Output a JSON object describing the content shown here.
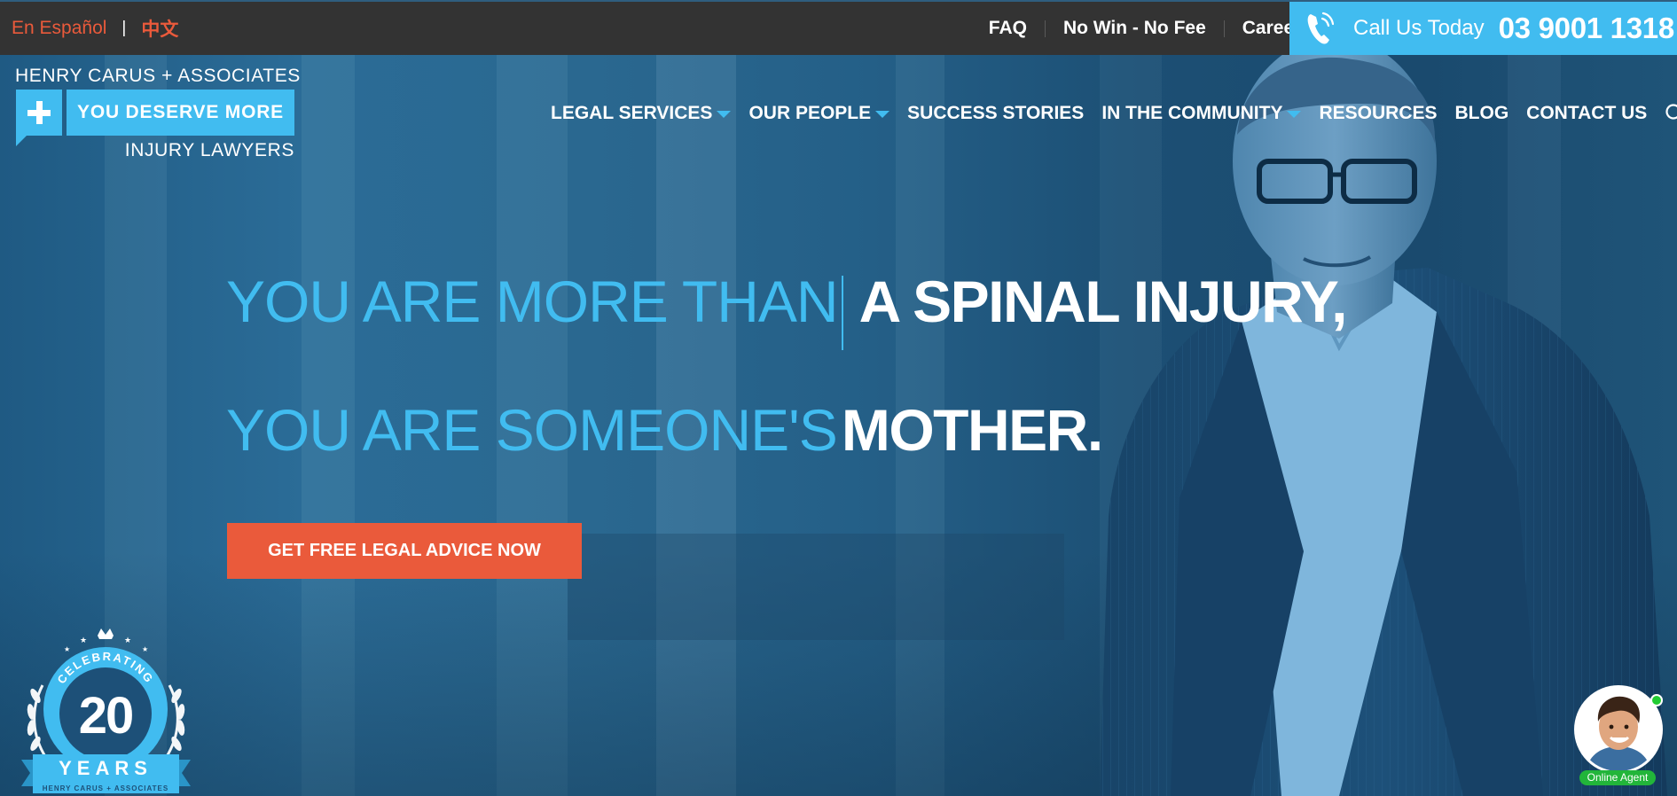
{
  "topbar": {
    "lang_es": "En Español",
    "lang_separator": "|",
    "lang_zh": "中文",
    "links": [
      "FAQ",
      "No Win - No Fee",
      "Careers"
    ],
    "call_label": "Call Us Today",
    "call_number": "03 9001 1318",
    "icons": {
      "phone": "phone-icon"
    },
    "colors": {
      "bar_bg": "#333333",
      "call_bg": "#41bcf0",
      "lang": "#ea5a3b"
    }
  },
  "logo": {
    "top_text": "HENRY CARUS + ASSOCIATES",
    "tagline": "YOU DESERVE MORE",
    "bottom_text": "INJURY LAWYERS"
  },
  "nav": {
    "items": [
      "LEGAL SERVICES",
      "OUR PEOPLE",
      "SUCCESS STORIES",
      "IN THE COMMUNITY",
      "RESOURCES",
      "BLOG",
      "CONTACT US"
    ],
    "dropdown_flags": [
      true,
      true,
      false,
      true,
      false,
      false,
      false
    ],
    "search_icon": "search-icon"
  },
  "hero": {
    "line1_light": "YOU ARE MORE THAN",
    "line1_bold": "A SPINAL INJURY,",
    "line2_light": "YOU ARE SOMEONE'S",
    "line2_bold": "MOTHER.",
    "cta_label": "GET FREE LEGAL ADVICE NOW",
    "colors": {
      "accent": "#41bcf0",
      "cta": "#ea5a3b"
    }
  },
  "badge": {
    "celebrating": "CELEBRATING",
    "number": "20",
    "years": "YEARS",
    "footer": "HENRY CARUS + ASSOCIATES"
  },
  "agent": {
    "label": "Online Agent",
    "status_color": "#22cc33"
  }
}
